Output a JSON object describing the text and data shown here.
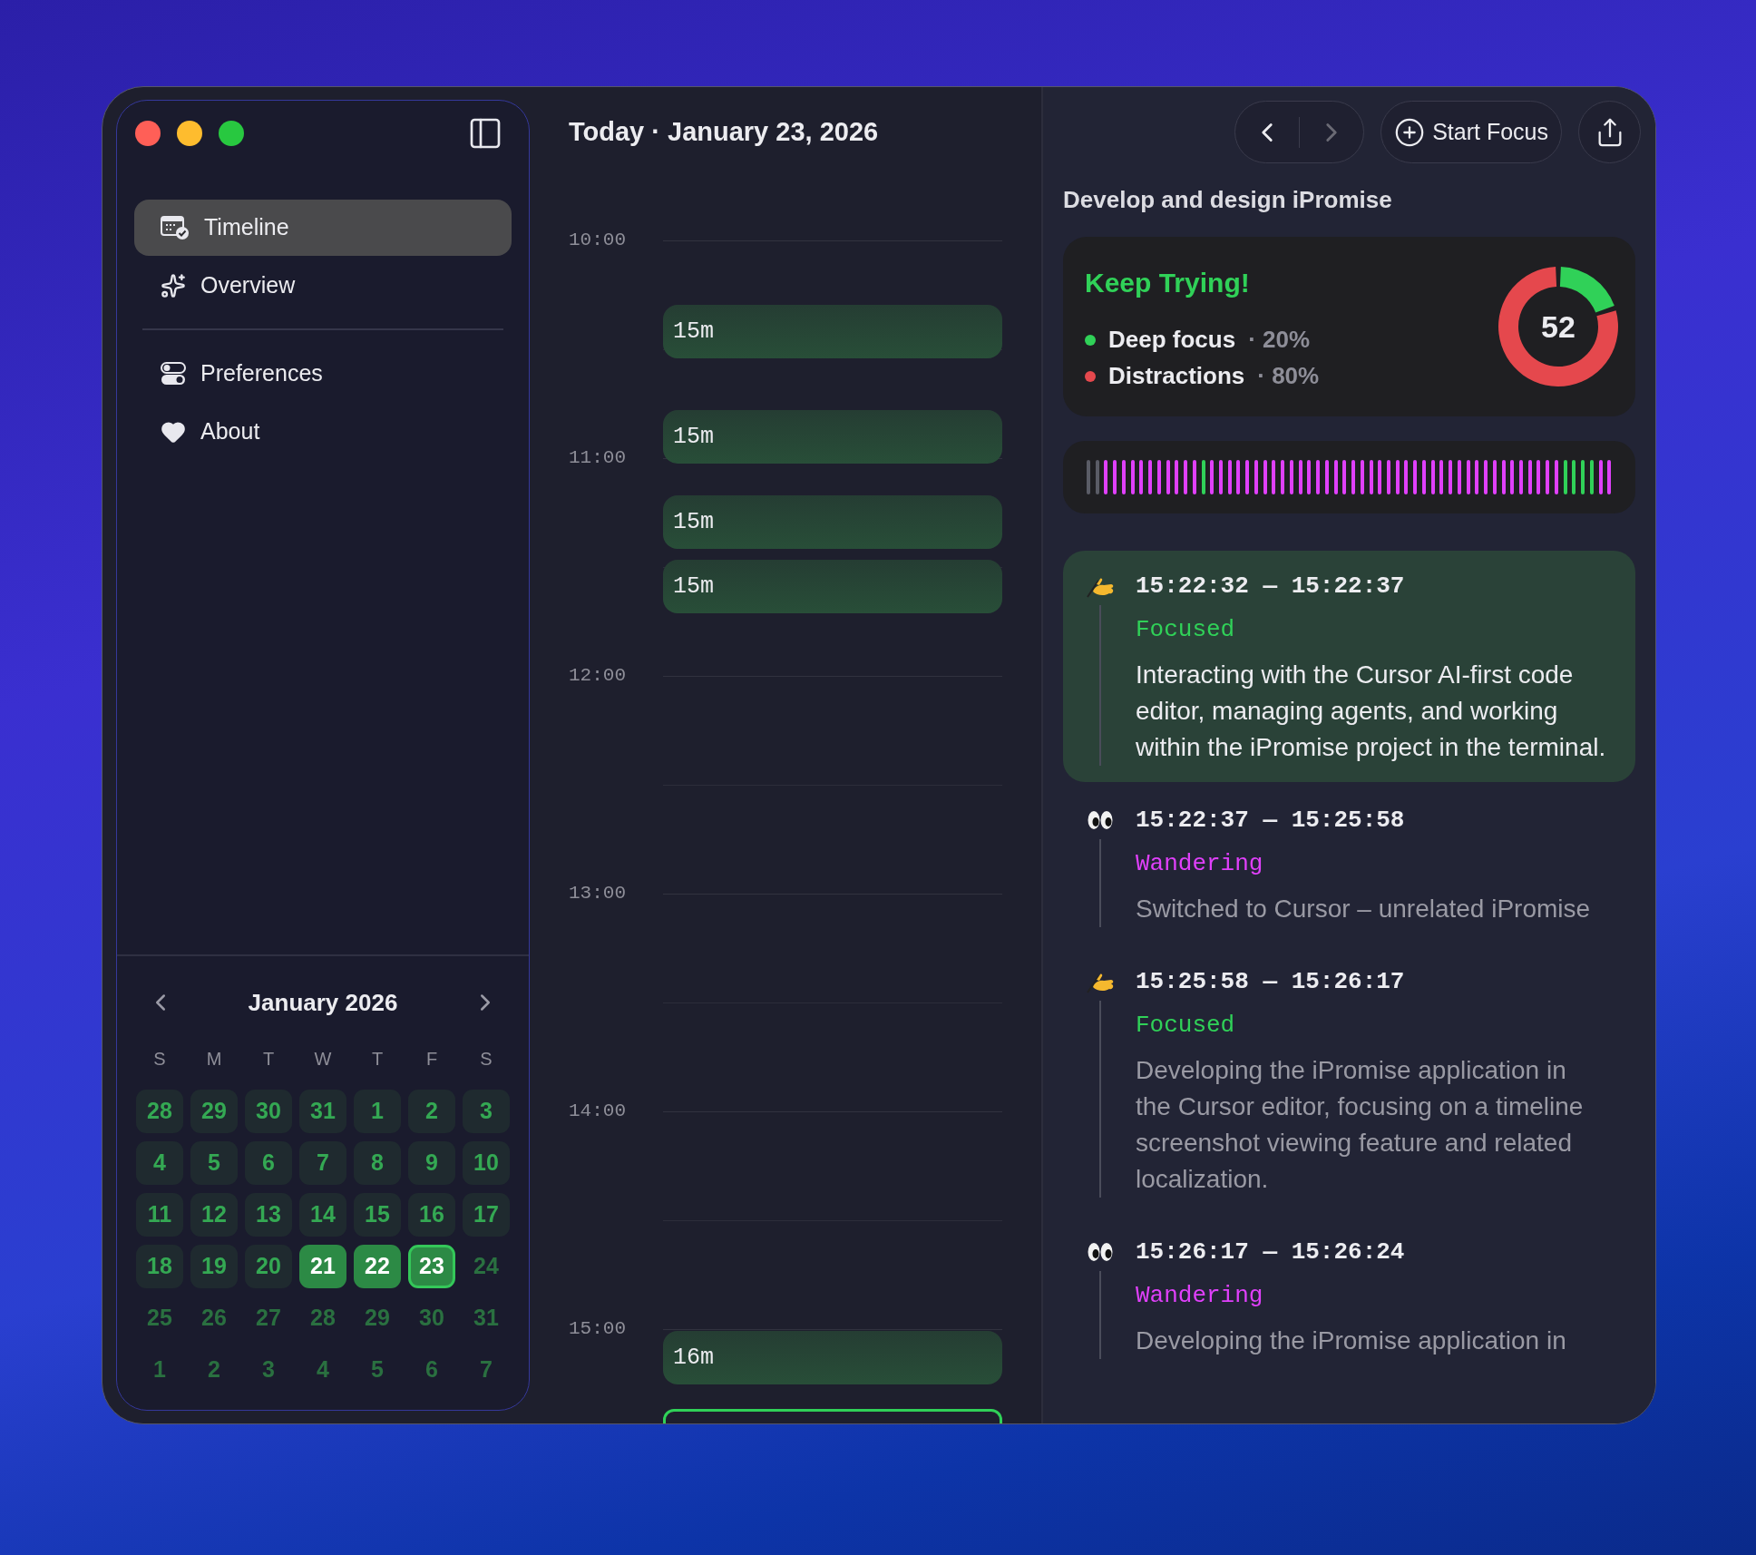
{
  "sidebar": {
    "sections": [
      {
        "items": [
          {
            "label": "Timeline",
            "selected": true
          },
          {
            "label": "Overview",
            "selected": false
          }
        ]
      },
      {
        "items": [
          {
            "label": "Preferences",
            "selected": false
          },
          {
            "label": "About",
            "selected": false
          }
        ]
      }
    ]
  },
  "calendar": {
    "month": "January 2026",
    "weekdays": [
      "S",
      "M",
      "T",
      "W",
      "T",
      "F",
      "S"
    ],
    "weeks": [
      [
        {
          "label": "28",
          "kind": "tracked",
          "selected": false
        },
        {
          "label": "29",
          "kind": "tracked",
          "selected": false
        },
        {
          "label": "30",
          "kind": "tracked",
          "selected": false
        },
        {
          "label": "31",
          "kind": "tracked",
          "selected": false
        },
        {
          "label": "1",
          "kind": "tracked",
          "selected": false
        },
        {
          "label": "2",
          "kind": "tracked",
          "selected": false
        },
        {
          "label": "3",
          "kind": "tracked",
          "selected": false
        }
      ],
      [
        {
          "label": "4",
          "kind": "tracked",
          "selected": false
        },
        {
          "label": "5",
          "kind": "tracked",
          "selected": false
        },
        {
          "label": "6",
          "kind": "tracked",
          "selected": false
        },
        {
          "label": "7",
          "kind": "tracked",
          "selected": false
        },
        {
          "label": "8",
          "kind": "tracked",
          "selected": false
        },
        {
          "label": "9",
          "kind": "tracked",
          "selected": false
        },
        {
          "label": "10",
          "kind": "tracked",
          "selected": false
        }
      ],
      [
        {
          "label": "11",
          "kind": "tracked",
          "selected": false
        },
        {
          "label": "12",
          "kind": "tracked",
          "selected": false
        },
        {
          "label": "13",
          "kind": "tracked",
          "selected": false
        },
        {
          "label": "14",
          "kind": "tracked",
          "selected": false
        },
        {
          "label": "15",
          "kind": "tracked",
          "selected": false
        },
        {
          "label": "16",
          "kind": "tracked",
          "selected": false
        },
        {
          "label": "17",
          "kind": "tracked",
          "selected": false
        }
      ],
      [
        {
          "label": "18",
          "kind": "tracked",
          "selected": false
        },
        {
          "label": "19",
          "kind": "tracked",
          "selected": false
        },
        {
          "label": "20",
          "kind": "tracked",
          "selected": false
        },
        {
          "label": "21",
          "kind": "active",
          "selected": false
        },
        {
          "label": "22",
          "kind": "active",
          "selected": false
        },
        {
          "label": "23",
          "kind": "active",
          "selected": true
        },
        {
          "label": "24",
          "kind": "plain",
          "selected": false
        }
      ],
      [
        {
          "label": "25",
          "kind": "plain",
          "selected": false
        },
        {
          "label": "26",
          "kind": "plain",
          "selected": false
        },
        {
          "label": "27",
          "kind": "plain",
          "selected": false
        },
        {
          "label": "28",
          "kind": "plain",
          "selected": false
        },
        {
          "label": "29",
          "kind": "plain",
          "selected": false
        },
        {
          "label": "30",
          "kind": "plain",
          "selected": false
        },
        {
          "label": "31",
          "kind": "plain",
          "selected": false
        }
      ],
      [
        {
          "label": "1",
          "kind": "plain",
          "selected": false
        },
        {
          "label": "2",
          "kind": "plain",
          "selected": false
        },
        {
          "label": "3",
          "kind": "plain",
          "selected": false
        },
        {
          "label": "4",
          "kind": "plain",
          "selected": false
        },
        {
          "label": "5",
          "kind": "plain",
          "selected": false
        },
        {
          "label": "6",
          "kind": "plain",
          "selected": false
        },
        {
          "label": "7",
          "kind": "plain",
          "selected": false
        }
      ]
    ]
  },
  "timeline": {
    "title": "Today · January 23, 2026",
    "hours": [
      "10:00",
      "11:00",
      "12:00",
      "13:00",
      "14:00",
      "15:00"
    ],
    "blocks": [
      {
        "kind": "session",
        "label": "15m"
      },
      {
        "kind": "session",
        "label": "15m"
      },
      {
        "kind": "session",
        "label": "15m"
      },
      {
        "kind": "session",
        "label": "15m"
      },
      {
        "kind": "session",
        "label": "16m"
      },
      {
        "kind": "live"
      }
    ]
  },
  "detail": {
    "nav": [
      {
        "kind": "back",
        "disabled": false
      },
      {
        "kind": "forward",
        "disabled": true
      }
    ],
    "start_button": "Start Focus",
    "title": "Develop and design iPromise",
    "score_card": {
      "headline": "Keep Trying!",
      "score": "52",
      "legend": [
        {
          "value": "· 20%",
          "color": "#30d158"
        },
        {
          "value": "· 80%",
          "color": "#e5484d"
        }
      ],
      "chart_data": {
        "type": "donut",
        "categories": [
          "Deep focus",
          "Distractions"
        ],
        "values": [
          20,
          80
        ]
      }
    },
    "strip": [
      {
        "color": "#5a5c66"
      },
      {
        "color": "#5a5c66"
      },
      {
        "color": "#e040fb"
      },
      {
        "color": "#e040fb"
      },
      {
        "color": "#e040fb"
      },
      {
        "color": "#e040fb"
      },
      {
        "color": "#e040fb"
      },
      {
        "color": "#e040fb"
      },
      {
        "color": "#e040fb"
      },
      {
        "color": "#e040fb"
      },
      {
        "color": "#e040fb"
      },
      {
        "color": "#e040fb"
      },
      {
        "color": "#e040fb"
      },
      {
        "color": "#30d158"
      },
      {
        "color": "#e040fb"
      },
      {
        "color": "#e040fb"
      },
      {
        "color": "#e040fb"
      },
      {
        "color": "#e040fb"
      },
      {
        "color": "#e040fb"
      },
      {
        "color": "#e040fb"
      },
      {
        "color": "#e040fb"
      },
      {
        "color": "#e040fb"
      },
      {
        "color": "#e040fb"
      },
      {
        "color": "#e040fb"
      },
      {
        "color": "#e040fb"
      },
      {
        "color": "#e040fb"
      },
      {
        "color": "#e040fb"
      },
      {
        "color": "#e040fb"
      },
      {
        "color": "#e040fb"
      },
      {
        "color": "#e040fb"
      },
      {
        "color": "#e040fb"
      },
      {
        "color": "#e040fb"
      },
      {
        "color": "#e040fb"
      },
      {
        "color": "#e040fb"
      },
      {
        "color": "#e040fb"
      },
      {
        "color": "#e040fb"
      },
      {
        "color": "#e040fb"
      },
      {
        "color": "#e040fb"
      },
      {
        "color": "#e040fb"
      },
      {
        "color": "#e040fb"
      },
      {
        "color": "#e040fb"
      },
      {
        "color": "#e040fb"
      },
      {
        "color": "#e040fb"
      },
      {
        "color": "#e040fb"
      },
      {
        "color": "#e040fb"
      },
      {
        "color": "#e040fb"
      },
      {
        "color": "#e040fb"
      },
      {
        "color": "#e040fb"
      },
      {
        "color": "#e040fb"
      },
      {
        "color": "#e040fb"
      },
      {
        "color": "#e040fb"
      },
      {
        "color": "#e040fb"
      },
      {
        "color": "#e040fb"
      },
      {
        "color": "#e040fb"
      },
      {
        "color": "#30d158"
      },
      {
        "color": "#30d158"
      },
      {
        "color": "#30d158"
      },
      {
        "color": "#30d158"
      },
      {
        "color": "#e040fb"
      },
      {
        "color": "#e040fb"
      }
    ],
    "events": [
      {
        "kind": "focused",
        "selected": true,
        "time": "15:22:32 — 15:22:37",
        "status": "Focused",
        "description": "Interacting with the Cursor AI-first code editor, managing agents, and working within the iPromise project in the terminal."
      },
      {
        "kind": "wandering",
        "selected": false,
        "time": "15:22:37 — 15:25:58",
        "status": "Wandering",
        "description": "Switched to Cursor – unrelated iPromise"
      },
      {
        "kind": "focused",
        "selected": false,
        "time": "15:25:58 — 15:26:17",
        "status": "Focused",
        "description": "Developing the iPromise application in the Cursor editor, focusing on a timeline screenshot viewing feature and related localization."
      },
      {
        "kind": "wandering",
        "selected": false,
        "time": "15:26:17 — 15:26:24",
        "status": "Wandering",
        "description": "Developing the iPromise application in"
      }
    ]
  }
}
